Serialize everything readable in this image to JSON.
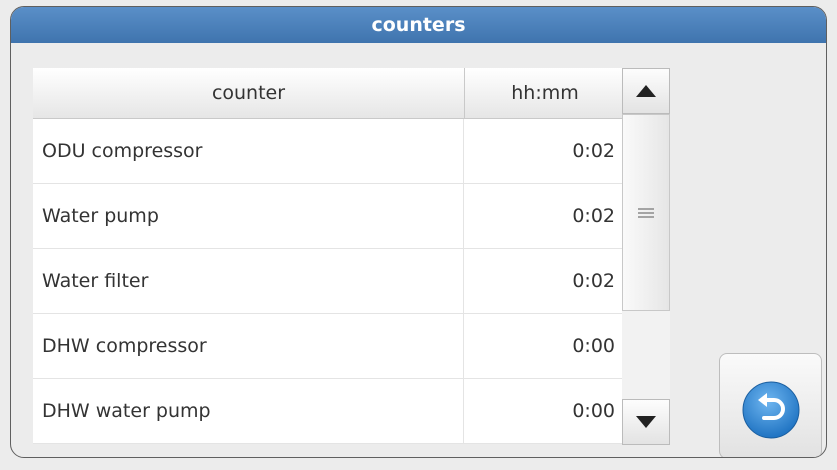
{
  "window": {
    "title": "counters"
  },
  "table": {
    "headers": {
      "counter": "counter",
      "time": "hh:mm"
    },
    "rows": [
      {
        "counter": "ODU compressor",
        "time": "0:02"
      },
      {
        "counter": "Water pump",
        "time": "0:02"
      },
      {
        "counter": "Water filter",
        "time": "0:02"
      },
      {
        "counter": "DHW compressor",
        "time": "0:00"
      },
      {
        "counter": "DHW water pump",
        "time": "0:00"
      }
    ]
  },
  "icons": {
    "scroll_up": "triangle-up-icon",
    "scroll_down": "triangle-down-icon",
    "thumb_grip": "grip-lines-icon",
    "back": "back-arrow-icon"
  },
  "colors": {
    "title_bar": "#4a80bb",
    "back_button": "#2f86d0"
  }
}
